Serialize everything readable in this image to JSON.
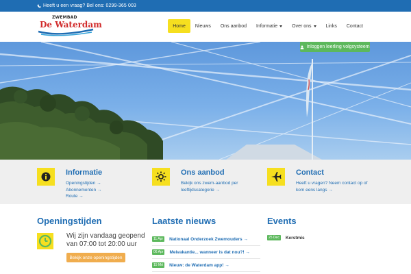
{
  "topbar": {
    "contact_text": "Heeft u een vraag? Bel ons: 0299-365 003"
  },
  "logo": {
    "small_text": "ZWEMBAD",
    "main_text": "De Waterdam"
  },
  "nav": {
    "items": [
      {
        "label": "Home",
        "active": true
      },
      {
        "label": "Nieuws"
      },
      {
        "label": "Ons aanbod"
      },
      {
        "label": "Informatie",
        "dropdown": true
      },
      {
        "label": "Over ons",
        "dropdown": true
      },
      {
        "label": "Links"
      },
      {
        "label": "Contact"
      }
    ]
  },
  "hero": {
    "login_label": "Inloggen leerling volgsysteem"
  },
  "features": [
    {
      "title": "Informatie",
      "icon": "info-icon",
      "links": [
        "Openingstijden →",
        "Abonnementen →",
        "Route →"
      ]
    },
    {
      "title": "Ons aanbod",
      "icon": "sun-icon",
      "desc": "Bekijk ons zwem-aanbod per leeftijdscategorie →"
    },
    {
      "title": "Contact",
      "icon": "airplane-icon",
      "desc": "Heeft u vragen? Neem contact op of kom eens langs →"
    }
  ],
  "opening": {
    "title": "Openingstijden",
    "line1": "Wij zijn vandaag geopend",
    "line2": "van 07:00 tot 20:00 uur",
    "button_label": "Bekijk onze openingstijden"
  },
  "news": {
    "title": "Laatste nieuws",
    "items": [
      {
        "date": "11 Apr",
        "text": "Nationaal Onderzoek Zwemouders →"
      },
      {
        "date": "06 Apr",
        "text": "Meivakantie... wanneer is dat nou?! →"
      },
      {
        "date": "15 Mrt",
        "text": "Nieuw: de Waterdam app! →"
      }
    ]
  },
  "events": {
    "title": "Events",
    "items": [
      {
        "date": "25 Dec",
        "text": "Kerstmis"
      }
    ]
  },
  "colors": {
    "brand_blue": "#1f6db3",
    "accent_yellow": "#f6df1f",
    "green": "#5cb85c",
    "orange": "#f0ad4e",
    "logo_red": "#d12b2b"
  }
}
